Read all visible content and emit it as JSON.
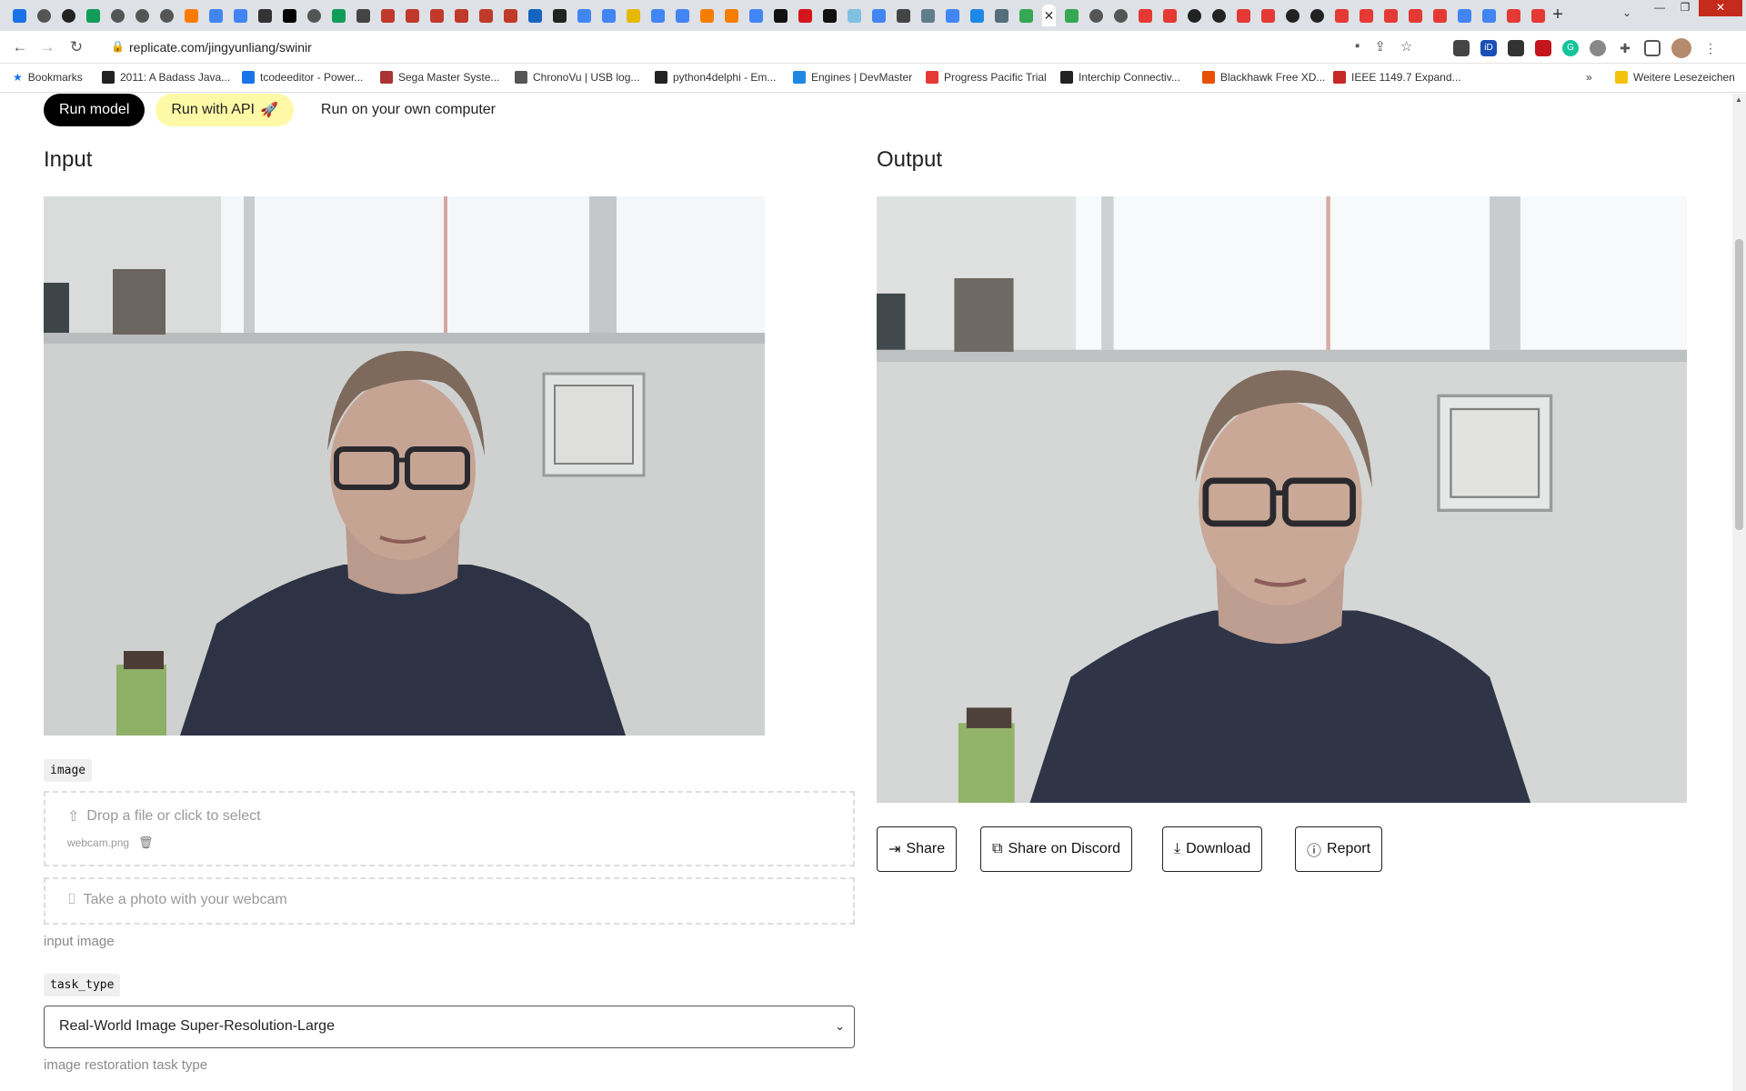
{
  "browser": {
    "url": "replicate.com/jingyunliang/swinir",
    "tab_close": "✕",
    "new_tab": "+",
    "bookmarks_label": "Bookmarks",
    "bookmarks": [
      "2011: A Badass Java...",
      "tcodeeditor - Power...",
      "Sega Master Syste...",
      "ChronoVu | USB log...",
      "python4delphi - Em...",
      "Engines | DevMaster",
      "Progress Pacific Trial",
      "Interchip Connectiv...",
      "Blackhawk Free XD...",
      "IEEE 1149.7 Expand..."
    ],
    "more_bookmarks": "»",
    "other_bookmarks": "Weitere Lesezeichen"
  },
  "actions": {
    "run_model": "Run model",
    "run_api": "Run with API",
    "run_own": "Run on your own computer"
  },
  "input": {
    "title": "Input",
    "image_label": "image",
    "drop_text": "Drop a file or click to select",
    "file_name": "webcam.png",
    "webcam_text": "Take a photo with your webcam",
    "image_hint": "input image",
    "task_label": "task_type",
    "task_value": "Real-World Image Super-Resolution-Large",
    "task_hint": "image restoration task type"
  },
  "output": {
    "title": "Output",
    "buttons": {
      "share": "Share",
      "discord": "Share on Discord",
      "download": "Download",
      "report": "Report"
    }
  },
  "icons": {
    "tab_favicons": [
      "gear",
      "chrome",
      "github",
      "sheets",
      "chrome",
      "chrome",
      "chrome",
      "orange",
      "google",
      "google",
      "box",
      "medium",
      "chrome",
      "sheets",
      "table",
      "redI",
      "redI",
      "redI",
      "redI",
      "redI",
      "redI",
      "fm",
      "amazon",
      "google",
      "google",
      "chart",
      "google",
      "google",
      "blogger",
      "blogger",
      "google",
      "play",
      "acrobat",
      "play",
      "bird",
      "google",
      "wiki",
      "box2",
      "google",
      "tshirt",
      "chart2",
      "green",
      "active",
      "green",
      "chrome",
      "chrome",
      "rocket",
      "rocket",
      "github",
      "github",
      "rocket",
      "rocket",
      "github",
      "github",
      "rocket",
      "rocket",
      "rocket",
      "rocket",
      "rocket",
      "google",
      "google",
      "rocket",
      "rocket"
    ]
  }
}
